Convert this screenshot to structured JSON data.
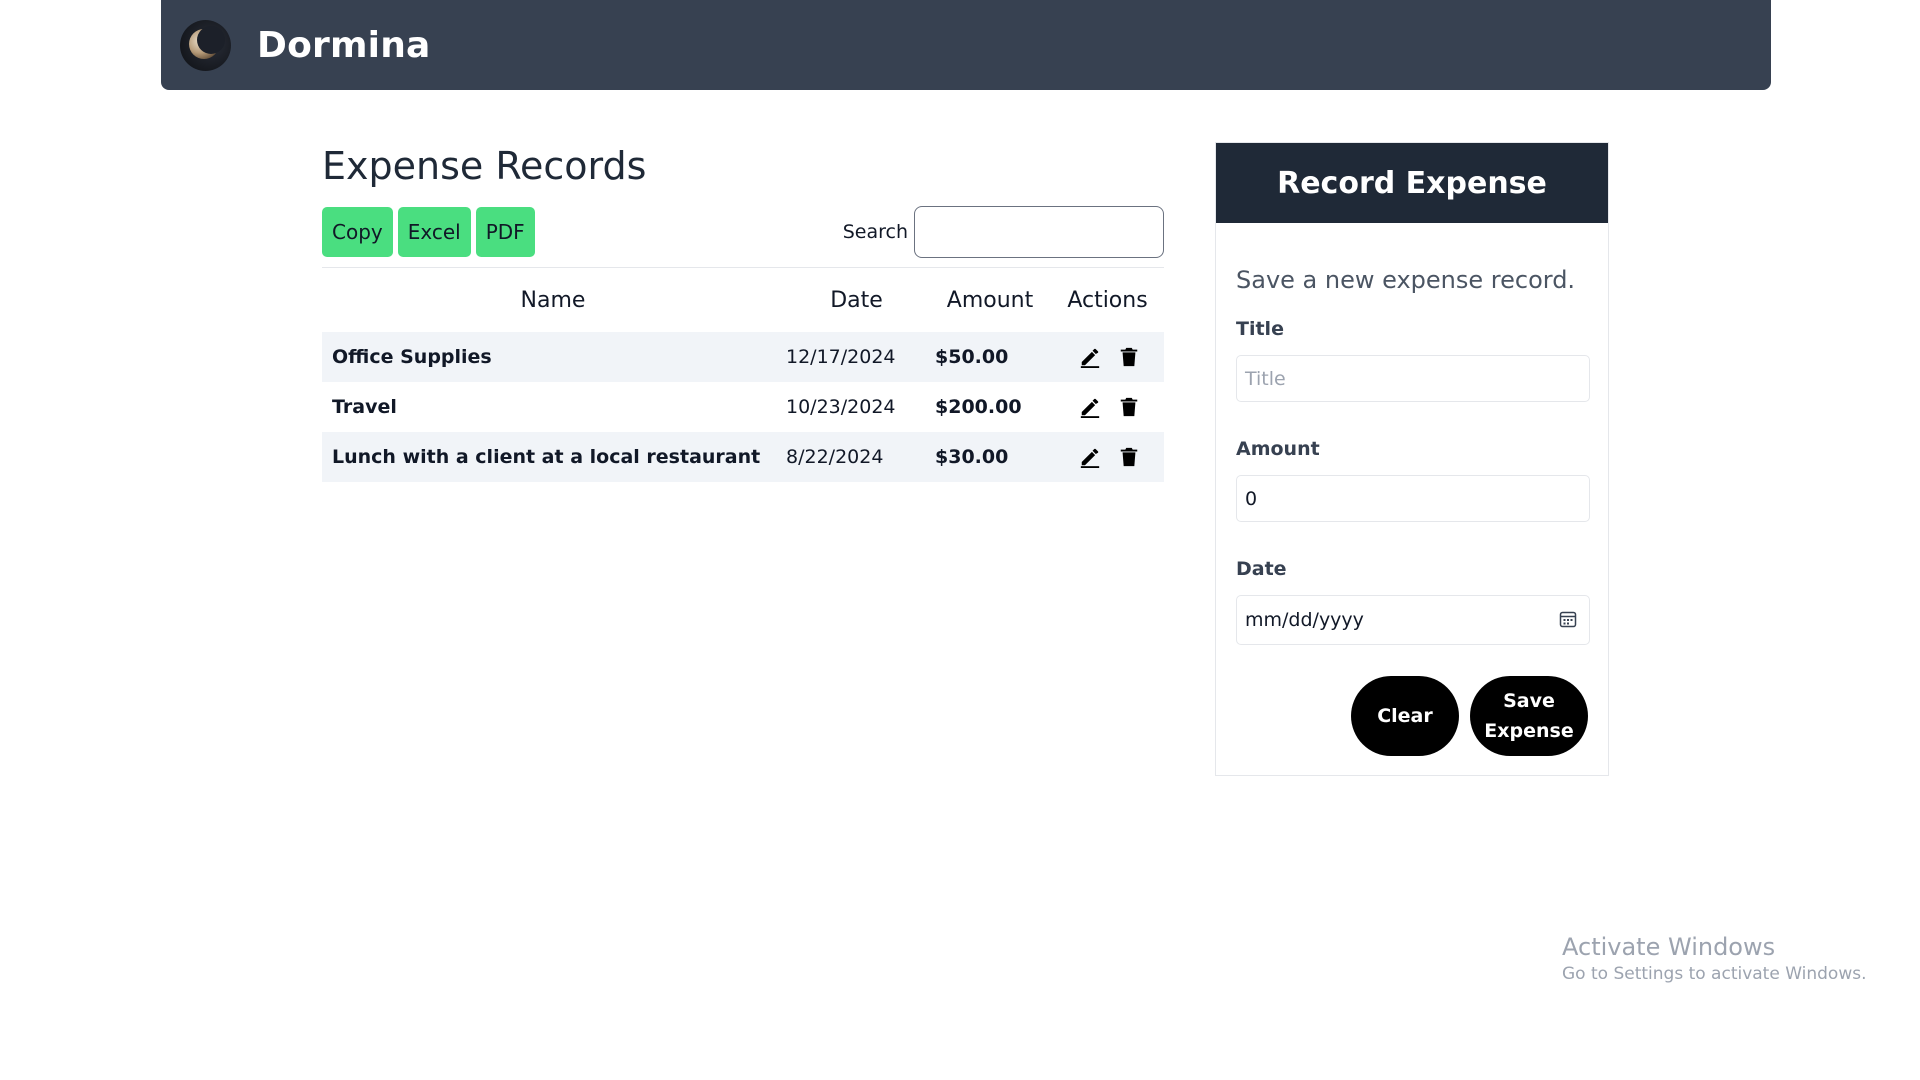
{
  "header": {
    "brand": "Dormina"
  },
  "records": {
    "title": "Expense Records",
    "export_buttons": [
      "Copy",
      "Excel",
      "PDF"
    ],
    "search": {
      "label": "Search",
      "value": ""
    },
    "columns": [
      "Name",
      "Date",
      "Amount",
      "Actions"
    ],
    "rows": [
      {
        "name": "Office Supplies",
        "date": "12/17/2024",
        "amount": "$50.00"
      },
      {
        "name": "Travel",
        "date": "10/23/2024",
        "amount": "$200.00"
      },
      {
        "name": "Lunch with a client at a local restaurant",
        "date": "8/22/2024",
        "amount": "$30.00"
      }
    ],
    "row_actions": [
      "pencil-icon",
      "trash-icon"
    ]
  },
  "form": {
    "title": "Record Expense",
    "subtitle": "Save a new expense record.",
    "title_label": "Title",
    "title_placeholder": "Title",
    "amount_label": "Amount",
    "amount_value": "0",
    "date_label": "Date",
    "date_placeholder": "mm/dd/yyyy",
    "clear_label": "Clear",
    "save_label_line1": "Save",
    "save_label_line2": "Expense"
  },
  "watermark": {
    "title": "Activate Windows",
    "subtitle": "Go to Settings to activate Windows."
  },
  "colors": {
    "header_bg": "#374151",
    "card_header_bg": "#1f2937",
    "export_button": "#4ade80",
    "row_shade": "#f1f4f8",
    "pill_button": "#000000"
  }
}
